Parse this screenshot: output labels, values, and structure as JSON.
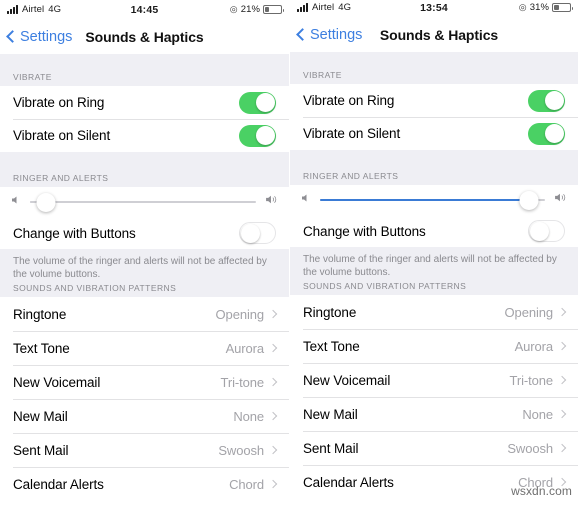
{
  "panels": [
    {
      "status": {
        "carrier": "Airtel",
        "network": "4G",
        "time": "14:45",
        "battery_percent": "21%",
        "battery_level": 21,
        "location_icon": "location-arrow-icon",
        "signal_icon": "signal-bars-icon",
        "battery_icon": "battery-icon"
      },
      "nav": {
        "back_label": "Settings",
        "title": "Sounds & Haptics",
        "back_icon": "chevron-left-icon"
      },
      "vibrate": {
        "header": "VIBRATE",
        "rows": [
          {
            "label": "Vibrate on Ring",
            "state": "on"
          },
          {
            "label": "Vibrate on Silent",
            "state": "on"
          }
        ]
      },
      "ringer": {
        "header": "RINGER AND ALERTS",
        "slider": {
          "value": 7,
          "fill_color": "#cfcfd4",
          "track_color": "#cfcfd4",
          "low_icon": "speaker-low-icon",
          "high_icon": "speaker-high-icon"
        },
        "change_with_buttons": {
          "label": "Change with Buttons",
          "state": "off"
        },
        "footnote": "The volume of the ringer and alerts will not be affected by the volume buttons."
      },
      "sounds": {
        "header": "SOUNDS AND VIBRATION PATTERNS",
        "rows": [
          {
            "label": "Ringtone",
            "value": "Opening"
          },
          {
            "label": "Text Tone",
            "value": "Aurora"
          },
          {
            "label": "New Voicemail",
            "value": "Tri-tone"
          },
          {
            "label": "New Mail",
            "value": "None"
          },
          {
            "label": "Sent Mail",
            "value": "Swoosh"
          },
          {
            "label": "Calendar Alerts",
            "value": "Chord"
          }
        ]
      }
    },
    {
      "status": {
        "carrier": "Airtel",
        "network": "4G",
        "time": "13:54",
        "battery_percent": "31%",
        "battery_level": 31,
        "location_icon": "location-arrow-icon",
        "signal_icon": "signal-bars-icon",
        "battery_icon": "battery-icon"
      },
      "nav": {
        "back_label": "Settings",
        "title": "Sounds & Haptics",
        "back_icon": "chevron-left-icon"
      },
      "vibrate": {
        "header": "VIBRATE",
        "rows": [
          {
            "label": "Vibrate on Ring",
            "state": "on"
          },
          {
            "label": "Vibrate on Silent",
            "state": "on"
          }
        ]
      },
      "ringer": {
        "header": "RINGER AND ALERTS",
        "slider": {
          "value": 93,
          "fill_color": "#3a7bd5",
          "track_color": "#cfcfd4",
          "low_icon": "speaker-low-icon",
          "high_icon": "speaker-high-icon"
        },
        "change_with_buttons": {
          "label": "Change with Buttons",
          "state": "off"
        },
        "footnote": "The volume of the ringer and alerts will not be affected by the volume buttons."
      },
      "sounds": {
        "header": "SOUNDS AND VIBRATION PATTERNS",
        "rows": [
          {
            "label": "Ringtone",
            "value": "Opening"
          },
          {
            "label": "Text Tone",
            "value": "Aurora"
          },
          {
            "label": "New Voicemail",
            "value": "Tri-tone"
          },
          {
            "label": "New Mail",
            "value": "None"
          },
          {
            "label": "Sent Mail",
            "value": "Swoosh"
          },
          {
            "label": "Calendar Alerts",
            "value": "Chord"
          }
        ]
      }
    }
  ],
  "watermark": "wsxdn.com",
  "colors": {
    "switch_on": "#4ad164",
    "tint_blue": "#3d7fe0",
    "slider_blue": "#3a7bd5",
    "group_bg": "#efeff4",
    "cell_bg": "#ffffff",
    "separator": "#e2e2e4",
    "secondary_text": "#8a8a8f"
  }
}
